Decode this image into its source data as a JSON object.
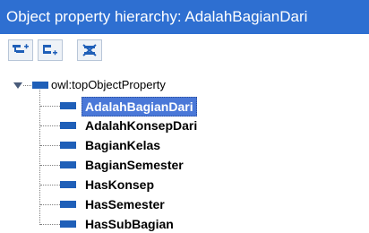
{
  "window": {
    "title": "Object property hierarchy: AdalahBagianDari"
  },
  "toolbar": {
    "buttons": [
      {
        "name": "add-subproperty-button",
        "icon": "add-subproperty-icon"
      },
      {
        "name": "add-sibling-property-button",
        "icon": "add-sibling-property-icon"
      },
      {
        "name": "delete-property-button",
        "icon": "delete-property-icon"
      }
    ]
  },
  "tree": {
    "root": {
      "label": "owl:topObjectProperty",
      "expanded": true
    },
    "children": [
      {
        "label": "AdalahBagianDari",
        "selected": true
      },
      {
        "label": "AdalahKonsepDari",
        "selected": false
      },
      {
        "label": "BagianKelas",
        "selected": false
      },
      {
        "label": "BagianSemester",
        "selected": false
      },
      {
        "label": "HasKonsep",
        "selected": false
      },
      {
        "label": "HasSemester",
        "selected": false
      },
      {
        "label": "HasSubBagian",
        "selected": false
      }
    ]
  },
  "colors": {
    "title_bg": "#2e6fd1",
    "selection_bg": "#4a78d8",
    "property_icon": "#1f5fb8"
  }
}
